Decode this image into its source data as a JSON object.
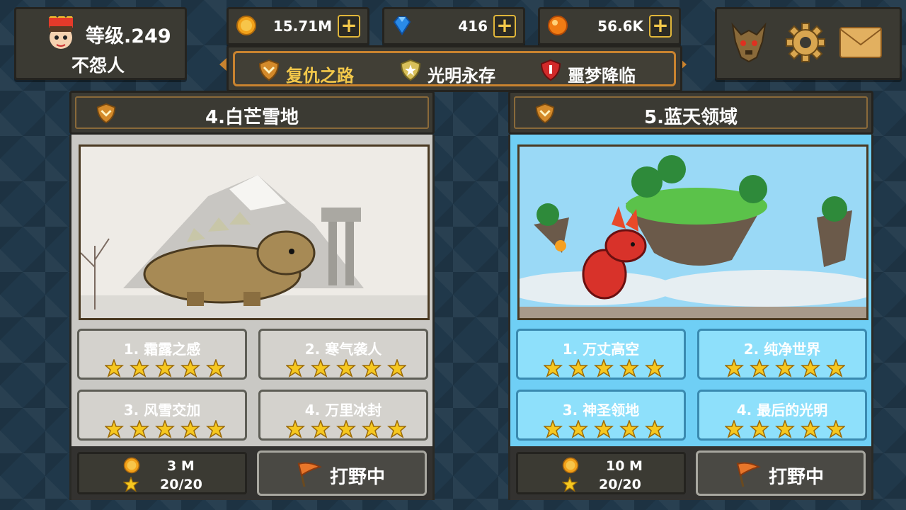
{
  "player": {
    "level": "等级.249",
    "name": "不怨人"
  },
  "currency": {
    "gold": "15.71M",
    "gems": "416",
    "orbs": "56.6K"
  },
  "tabs": [
    {
      "label": "复仇之路",
      "color": "#f3c84a",
      "icon": "bronze-shield-icon"
    },
    {
      "label": "光明永存",
      "color": "#ffffff",
      "icon": "silver-shield-icon"
    },
    {
      "label": "噩梦降临",
      "color": "#ffffff",
      "icon": "red-shield-icon"
    }
  ],
  "topright": {
    "icons": [
      "dragon-boss-icon",
      "gear-icon",
      "mail-icon"
    ]
  },
  "maps": [
    {
      "title": "4.白芒雪地",
      "theme": "snow",
      "levels": [
        {
          "name": "1. 霜露之感",
          "stars": 5
        },
        {
          "name": "2. 寒气袭人",
          "stars": 5
        },
        {
          "name": "3. 风雪交加",
          "stars": 5
        },
        {
          "name": "4. 万里冰封",
          "stars": 5
        }
      ],
      "reward_gold": "3 M",
      "reward_stars": "20/20",
      "button": "打野中"
    },
    {
      "title": "5.蓝天领域",
      "theme": "sky",
      "levels": [
        {
          "name": "1. 万丈高空",
          "stars": 5
        },
        {
          "name": "2. 纯净世界",
          "stars": 5
        },
        {
          "name": "3. 神圣领地",
          "stars": 5
        },
        {
          "name": "4. 最后的光明",
          "stars": 5
        }
      ],
      "reward_gold": "10 M",
      "reward_stars": "20/20",
      "button": "打野中"
    }
  ],
  "colors": {
    "panel": "#3b3a33",
    "accent": "#c9832f",
    "snow_body": "#c9c8c4",
    "sky_body": "#6fcff5",
    "star": "#f6c820"
  }
}
